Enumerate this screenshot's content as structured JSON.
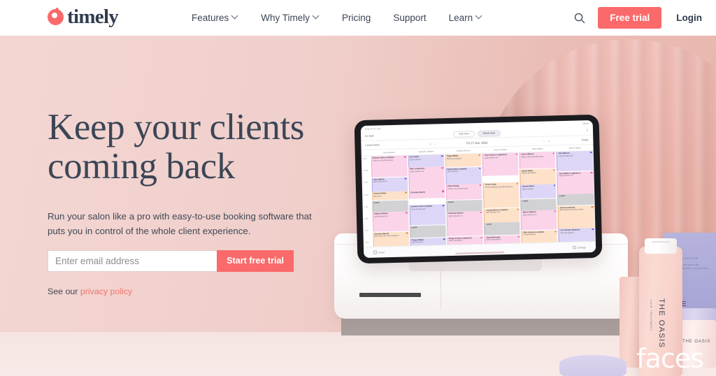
{
  "brand": {
    "name": "timely",
    "logo_icon": "timely-circle-logo",
    "accent_color": "#fa6a6a",
    "text_color": "#313c4e"
  },
  "header": {
    "nav": [
      {
        "label": "Features",
        "has_dropdown": true
      },
      {
        "label": "Why Timely",
        "has_dropdown": true
      },
      {
        "label": "Pricing",
        "has_dropdown": false
      },
      {
        "label": "Support",
        "has_dropdown": false
      },
      {
        "label": "Learn",
        "has_dropdown": true
      }
    ],
    "search_icon": "search-icon",
    "free_trial_label": "Free trial",
    "login_label": "Login"
  },
  "hero": {
    "headline_line1": "Keep your clients",
    "headline_line2": "coming back",
    "subcopy": "Run your salon like a pro with easy-to-use booking software that puts you in control of the whole client experience.",
    "email_placeholder": "Enter email address",
    "email_value": "",
    "cta_label": "Start free trial",
    "privacy_prefix": "See our",
    "privacy_link": "privacy policy",
    "background_colors": {
      "wall_top": "#f3d6d2",
      "wall_right": "#e8b7ae",
      "arch": "#e9ada3",
      "floor": "#f7e8e6"
    }
  },
  "tablet": {
    "statusbar_left": "9:41  Fri 17 Jun",
    "statusbar_right": "100%",
    "toolbar_left": "All Staff",
    "toolbar_buttons": [
      "Day view",
      "Week view"
    ],
    "toolbar_selected": "Week view",
    "share_icon": "share-icon",
    "staff_filter": "Laura Eaton",
    "date_label": "Fri 17 Jun, 2022",
    "today_label": "Today",
    "prev_icons": "«  ‹",
    "next_icons": "›  »",
    "columns": [
      "Laura Eaton",
      "Jasmine Walker",
      "Sophie Brown",
      "Aaron Dudley",
      "Molly Baker",
      "Jamie Taylor"
    ],
    "times": [
      "9:00",
      "10:00",
      "11:00",
      "12:00",
      "1:00",
      "2:00",
      "3:00",
      "4:00"
    ],
    "bottom_left": "Home",
    "bottom_right": "Settings",
    "event_colors": {
      "pink": "#fbd4ea",
      "purple": "#ded6f6",
      "peach": "#fde1c9",
      "gray": "#d2d2d4"
    },
    "events": {
      "col1": [
        {
          "title": "Hannah Jakes-Letatham",
          "sub": "Colour, cut and blow wave",
          "color": "pink",
          "h": 30,
          "dot": true
        },
        {
          "title": "Laura Marsh",
          "sub": "Light coloured cut",
          "color": "purple",
          "h": 20,
          "dot": true
        },
        {
          "title": "Jeremy Parker",
          "sub": "Mens cuts",
          "color": "peach",
          "h": 12,
          "dot": true
        },
        {
          "title": "Lunch",
          "sub": "",
          "color": "gray",
          "h": 16,
          "dot": false
        },
        {
          "title": "Addison Parker",
          "sub": "Light coloured cut",
          "color": "pink",
          "h": 28,
          "dot": true
        },
        {
          "title": "Christina Merrill",
          "sub": "Blow wave and wash treatment",
          "color": "peach",
          "h": 26,
          "dot": true
        }
      ],
      "col2": [
        {
          "title": "Eve Smith",
          "sub": "Light coloured",
          "color": "purple",
          "h": 17,
          "dot": true
        },
        {
          "title": "Mia Longbottom",
          "sub": "Light coloured cut",
          "color": "pink",
          "h": 34,
          "dot": true
        },
        {
          "title": "Christina Merrill",
          "sub": "",
          "color": "pink",
          "h": 12,
          "dot": true
        },
        {
          "title": "",
          "sub": "",
          "color": "white",
          "h": 8,
          "dot": false
        },
        {
          "title": "Amelia Foster-Letatham",
          "sub": "Laser lift wave trim",
          "color": "purple",
          "h": 30,
          "dot": true
        },
        {
          "title": "Lunch",
          "sub": "",
          "color": "gray",
          "h": 18,
          "dot": false
        },
        {
          "title": "Poppy Walker",
          "sub": "Light coloured",
          "color": "purple",
          "h": 20,
          "dot": true
        }
      ],
      "col3": [
        {
          "title": "Paige Walker",
          "sub": "Blonde specialised",
          "color": "peach",
          "h": 18,
          "dot": true
        },
        {
          "title": "Emma Allen-Letatham",
          "sub": "Light coloured",
          "color": "purple",
          "h": 24,
          "dot": true
        },
        {
          "title": "Chloe Budge",
          "sub": "Colour, cut and blow wave",
          "color": "pink",
          "h": 22,
          "dot": true
        },
        {
          "title": "Lunch",
          "sub": "",
          "color": "gray",
          "h": 16,
          "dot": false
        },
        {
          "title": "Charlotte Barrett",
          "sub": "Light coloured cut",
          "color": "pink",
          "h": 35,
          "dot": true
        },
        {
          "title": "Poppy Frank-Longbottom",
          "sub": "Mens specialised",
          "color": "pink",
          "h": 20,
          "dot": true
        }
      ],
      "col4": [
        {
          "title": "Grace Harris-Longbottom",
          "sub": "Light coloured cut",
          "color": "pink",
          "h": 32,
          "dot": true
        },
        {
          "title": "",
          "sub": "",
          "color": "white",
          "h": 9,
          "dot": false
        },
        {
          "title": "Emma Laing",
          "sub": "Blonde balayage and hair treatment",
          "color": "peach",
          "h": 36,
          "dot": true
        },
        {
          "title": "Lucinda Morris-Letatham",
          "sub": "Laser lift wave trim",
          "color": "peach",
          "h": 20,
          "dot": true
        },
        {
          "title": "Lunch",
          "sub": "",
          "color": "gray",
          "h": 18,
          "dot": false
        },
        {
          "title": "Riley McDonald",
          "sub": "Blonde specialised",
          "color": "pink",
          "h": 20,
          "dot": true
        }
      ],
      "col5": [
        {
          "title": "Aaron Watson",
          "sub": "Wash, colour and blow wave",
          "color": "pink",
          "h": 23,
          "dot": true
        },
        {
          "title": "Daniel Baker",
          "sub": "Blonde specialised",
          "color": "peach",
          "h": 22,
          "dot": true
        },
        {
          "title": "Hannah Ward",
          "sub": "Light coloured",
          "color": "purple",
          "h": 20,
          "dot": true
        },
        {
          "title": "Lunch",
          "sub": "",
          "color": "gray",
          "h": 16,
          "dot": false
        },
        {
          "title": "Nelson Watson",
          "sub": "Light coloured cut",
          "color": "pink",
          "h": 28,
          "dot": true
        },
        {
          "title": "Ellie Osborne-Letatham",
          "sub": "Overall teaming",
          "color": "peach",
          "h": 18,
          "dot": true
        }
      ],
      "col6": [
        {
          "title": "Sam Watson",
          "sub": "Laser lift wave trim",
          "color": "purple",
          "h": 28,
          "dot": true
        },
        {
          "title": "Tony White-Longbottom",
          "sub": "Light coloured cut",
          "color": "pink",
          "h": 32,
          "dot": true
        },
        {
          "title": "Lunch",
          "sub": "",
          "color": "gray",
          "h": 16,
          "dot": false
        },
        {
          "title": "Jamie Archbould",
          "sub": "Blow balance and hair combin",
          "color": "peach",
          "h": 32,
          "dot": true
        },
        {
          "title": "Lisa Temple-Stephens",
          "sub": "Laser lift quarters",
          "color": "purple",
          "h": 24,
          "dot": true
        }
      ]
    }
  },
  "products": {
    "bottle_label": "THE OASIS",
    "bottle_sublabel": "HAIR TREATMENT",
    "box_label": "THE OASIS",
    "box_heading": "SERUM STYLER",
    "box_body": "Dry conditioner serum with essentials for finer to dry perfection",
    "jar_label": "THE OASIS"
  },
  "watermark": "faces"
}
